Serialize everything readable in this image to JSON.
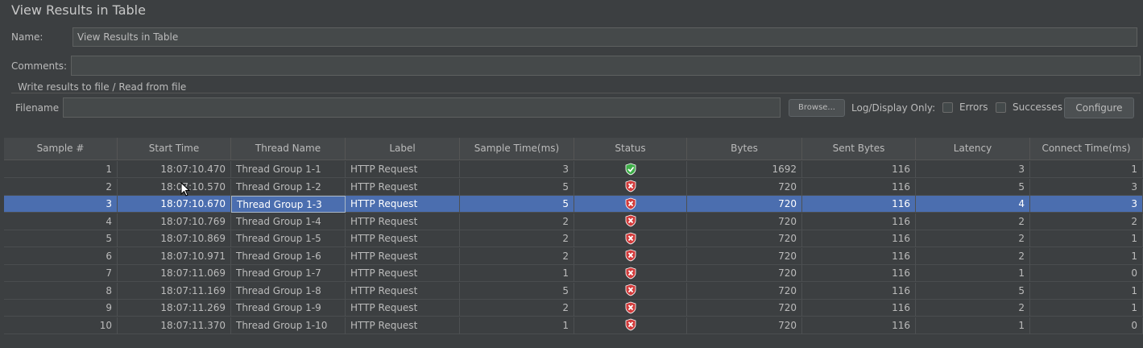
{
  "title": "View Results in Table",
  "name": {
    "label": "Name:",
    "value": "View Results in Table"
  },
  "comments": {
    "label": "Comments:",
    "value": ""
  },
  "file_group": {
    "title": "Write results to file / Read from file",
    "filename_label": "Filename",
    "filename_value": "",
    "browse_label": "Browse...",
    "log_display_label": "Log/Display Only:",
    "errors_label": "Errors",
    "successes_label": "Successes",
    "configure_label": "Configure"
  },
  "colors": {
    "success": "#3fae49",
    "error": "#d23b3b",
    "selection": "#4b6eaf"
  },
  "table": {
    "columns": [
      "Sample #",
      "Start Time",
      "Thread Name",
      "Label",
      "Sample Time(ms)",
      "Status",
      "Bytes",
      "Sent Bytes",
      "Latency",
      "Connect Time(ms)"
    ],
    "selected_row": 2,
    "rows": [
      {
        "sample": "1",
        "start": "18:07:10.470",
        "thread": "Thread Group 1-1",
        "label": "HTTP Request",
        "time": "3",
        "status": "success",
        "bytes": "1692",
        "sent": "116",
        "latency": "3",
        "connect": "1"
      },
      {
        "sample": "2",
        "start": "18:07:10.570",
        "thread": "Thread Group 1-2",
        "label": "HTTP Request",
        "time": "5",
        "status": "error",
        "bytes": "720",
        "sent": "116",
        "latency": "5",
        "connect": "3"
      },
      {
        "sample": "3",
        "start": "18:07:10.670",
        "thread": "Thread Group 1-3",
        "label": "HTTP Request",
        "time": "5",
        "status": "error",
        "bytes": "720",
        "sent": "116",
        "latency": "4",
        "connect": "3"
      },
      {
        "sample": "4",
        "start": "18:07:10.769",
        "thread": "Thread Group 1-4",
        "label": "HTTP Request",
        "time": "2",
        "status": "error",
        "bytes": "720",
        "sent": "116",
        "latency": "2",
        "connect": "2"
      },
      {
        "sample": "5",
        "start": "18:07:10.869",
        "thread": "Thread Group 1-5",
        "label": "HTTP Request",
        "time": "2",
        "status": "error",
        "bytes": "720",
        "sent": "116",
        "latency": "2",
        "connect": "1"
      },
      {
        "sample": "6",
        "start": "18:07:10.971",
        "thread": "Thread Group 1-6",
        "label": "HTTP Request",
        "time": "2",
        "status": "error",
        "bytes": "720",
        "sent": "116",
        "latency": "2",
        "connect": "1"
      },
      {
        "sample": "7",
        "start": "18:07:11.069",
        "thread": "Thread Group 1-7",
        "label": "HTTP Request",
        "time": "1",
        "status": "error",
        "bytes": "720",
        "sent": "116",
        "latency": "1",
        "connect": "0"
      },
      {
        "sample": "8",
        "start": "18:07:11.169",
        "thread": "Thread Group 1-8",
        "label": "HTTP Request",
        "time": "5",
        "status": "error",
        "bytes": "720",
        "sent": "116",
        "latency": "5",
        "connect": "1"
      },
      {
        "sample": "9",
        "start": "18:07:11.269",
        "thread": "Thread Group 1-9",
        "label": "HTTP Request",
        "time": "2",
        "status": "error",
        "bytes": "720",
        "sent": "116",
        "latency": "2",
        "connect": "1"
      },
      {
        "sample": "10",
        "start": "18:07:11.370",
        "thread": "Thread Group 1-10",
        "label": "HTTP Request",
        "time": "1",
        "status": "error",
        "bytes": "720",
        "sent": "116",
        "latency": "1",
        "connect": "0"
      }
    ]
  }
}
